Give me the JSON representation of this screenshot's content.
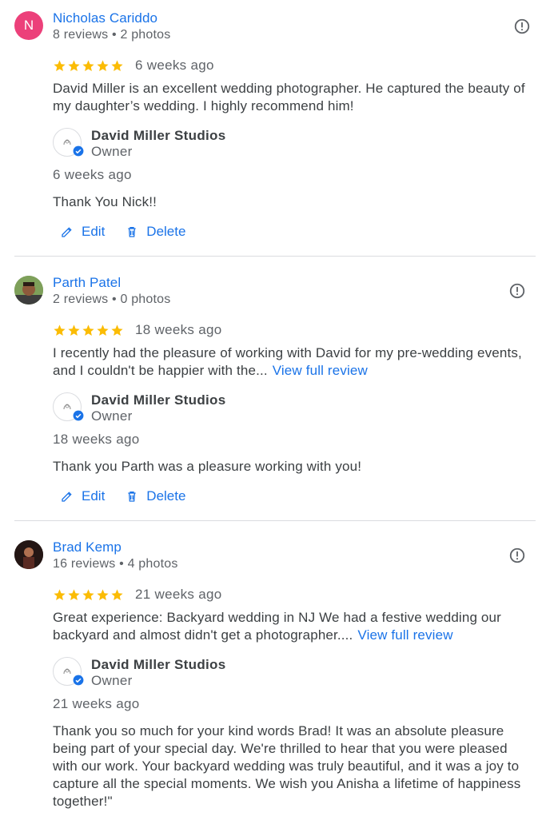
{
  "colors": {
    "link": "#1a73e8",
    "star": "#fbbc04",
    "avatar_n": "#ec407a"
  },
  "reviews": [
    {
      "avatar_letter": "N",
      "name": "Nicholas Cariddo",
      "meta": "8 reviews • 2 photos",
      "rating": 5,
      "when": "6 weeks ago",
      "text": "David Miller is an excellent wedding photographer. He captured the beauty of my daughter’s wedding. I highly recommend him!",
      "owner_name": "David Miller Studios",
      "owner_role": "Owner",
      "reply_when": "6 weeks ago",
      "reply": "Thank You Nick!!",
      "edit": "Edit",
      "delete": "Delete"
    },
    {
      "name": "Parth Patel",
      "meta": "2 reviews • 0 photos",
      "rating": 5,
      "when": "18 weeks ago",
      "text": "I recently had the pleasure of working with David for my pre-wedding events, and I couldn't be happier with the...",
      "more": "View full review",
      "owner_name": "David Miller Studios",
      "owner_role": "Owner",
      "reply_when": "18 weeks ago",
      "reply": "Thank you Parth was a pleasure working with you!",
      "edit": "Edit",
      "delete": "Delete"
    },
    {
      "name": "Brad Kemp",
      "meta": "16 reviews • 4 photos",
      "rating": 5,
      "when": "21 weeks ago",
      "text": "Great experience: Backyard wedding in NJ We had a festive wedding our backyard and almost didn't get a photographer....",
      "more": "View full review",
      "owner_name": "David Miller Studios",
      "owner_role": "Owner",
      "reply_when": "21 weeks ago",
      "reply": "Thank you so much for your kind words Brad! It was an absolute pleasure being part of your special day. We're thrilled to hear that you were pleased with our work. Your backyard wedding was truly beautiful, and it was a joy to capture all the special moments. We wish you Anisha a lifetime of happiness together!\""
    }
  ]
}
